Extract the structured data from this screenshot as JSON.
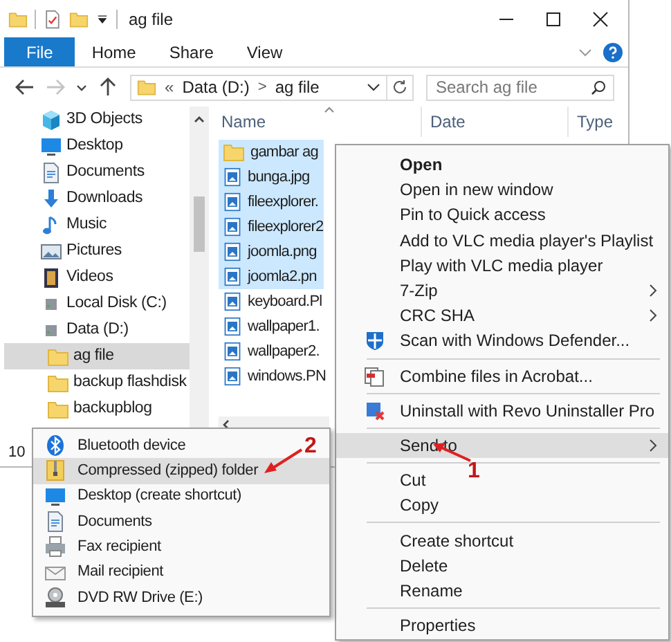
{
  "window": {
    "title": "ag file"
  },
  "ribbon": {
    "tabs": [
      {
        "label": "File",
        "kind": "file",
        "selected": false
      },
      {
        "label": "Home",
        "kind": "tab",
        "selected": false
      },
      {
        "label": "Share",
        "kind": "tab",
        "selected": false
      },
      {
        "label": "View",
        "kind": "tab",
        "selected": false
      }
    ]
  },
  "navigation": {
    "buttons": [
      {
        "kind": "back",
        "disabled": false
      },
      {
        "kind": "forward",
        "disabled": true
      },
      {
        "kind": "recent",
        "disabled": false
      },
      {
        "kind": "up",
        "disabled": false
      }
    ]
  },
  "address_bar": {
    "overflow": "«",
    "separator": ">",
    "path": [
      "Data (D:)",
      "ag file"
    ]
  },
  "search": {
    "placeholder": "Search ag file"
  },
  "nav_pane": {
    "items": [
      {
        "label": "3D Objects",
        "kind": "objects3d",
        "selected": false,
        "indented": false
      },
      {
        "label": "Desktop",
        "kind": "desktop",
        "selected": false,
        "indented": false
      },
      {
        "label": "Documents",
        "kind": "documents",
        "selected": false,
        "indented": false
      },
      {
        "label": "Downloads",
        "kind": "downloads",
        "selected": false,
        "indented": false
      },
      {
        "label": "Music",
        "kind": "music",
        "selected": false,
        "indented": false
      },
      {
        "label": "Pictures",
        "kind": "pictures",
        "selected": false,
        "indented": false
      },
      {
        "label": "Videos",
        "kind": "videos",
        "selected": false,
        "indented": false
      },
      {
        "label": "Local Disk (C:)",
        "kind": "drive",
        "selected": false,
        "indented": false
      },
      {
        "label": "Data (D:)",
        "kind": "drive",
        "selected": false,
        "indented": false
      },
      {
        "label": "ag file",
        "kind": "folder",
        "selected": true,
        "indented": true
      },
      {
        "label": "backup flashdisk",
        "kind": "folder",
        "selected": false,
        "indented": true
      },
      {
        "label": "backupblog",
        "kind": "folder",
        "selected": false,
        "indented": true
      }
    ]
  },
  "file_list": {
    "columns": [
      "Name",
      "Date",
      "Type"
    ],
    "rows": [
      {
        "name": "gambar ag",
        "kind": "folder",
        "selected": true
      },
      {
        "name": "bunga.jpg",
        "kind": "image",
        "selected": true
      },
      {
        "name": "fileexplorer.",
        "kind": "image",
        "selected": true
      },
      {
        "name": "fileexplorer2",
        "kind": "image",
        "selected": true
      },
      {
        "name": "joomla.png",
        "kind": "image",
        "selected": true
      },
      {
        "name": "joomla2.pn",
        "kind": "image",
        "selected": true
      },
      {
        "name": "keyboard.Pl",
        "kind": "image",
        "selected": false
      },
      {
        "name": "wallpaper1.",
        "kind": "image",
        "selected": false
      },
      {
        "name": "wallpaper2.",
        "kind": "image",
        "selected": false
      },
      {
        "name": "windows.PN",
        "kind": "image",
        "selected": false
      }
    ]
  },
  "status_bar": {
    "text": "10"
  },
  "context_menu": {
    "items": [
      {
        "label": "Open",
        "kind": "plain",
        "default": true,
        "submenu": false,
        "selected": false
      },
      {
        "label": "Open in new window",
        "kind": "plain",
        "default": false,
        "submenu": false,
        "selected": false
      },
      {
        "label": "Pin to Quick access",
        "kind": "plain",
        "default": false,
        "submenu": false,
        "selected": false
      },
      {
        "label": "Add to VLC media player's Playlist",
        "kind": "plain",
        "default": false,
        "submenu": false,
        "selected": false
      },
      {
        "label": "Play with VLC media player",
        "kind": "plain",
        "default": false,
        "submenu": false,
        "selected": false
      },
      {
        "label": "7-Zip",
        "kind": "plain",
        "default": false,
        "submenu": true,
        "selected": false
      },
      {
        "label": "CRC SHA",
        "kind": "plain",
        "default": false,
        "submenu": true,
        "selected": false
      },
      {
        "label": "Scan with Windows Defender...",
        "kind": "shield",
        "default": false,
        "submenu": false,
        "selected": false
      },
      {
        "kind": "separator"
      },
      {
        "label": "Combine files in Acrobat...",
        "kind": "acrobat",
        "default": false,
        "submenu": false,
        "selected": false
      },
      {
        "kind": "separator"
      },
      {
        "label": "Uninstall with Revo Uninstaller Pro",
        "kind": "revo",
        "default": false,
        "submenu": false,
        "selected": false
      },
      {
        "kind": "separator"
      },
      {
        "label": "Send to",
        "kind": "plain",
        "default": false,
        "submenu": true,
        "selected": true
      },
      {
        "kind": "separator"
      },
      {
        "label": "Cut",
        "kind": "plain",
        "default": false,
        "submenu": false,
        "selected": false
      },
      {
        "label": "Copy",
        "kind": "plain",
        "default": false,
        "submenu": false,
        "selected": false
      },
      {
        "kind": "separator"
      },
      {
        "label": "Create shortcut",
        "kind": "plain",
        "default": false,
        "submenu": false,
        "selected": false
      },
      {
        "label": "Delete",
        "kind": "plain",
        "default": false,
        "submenu": false,
        "selected": false
      },
      {
        "label": "Rename",
        "kind": "plain",
        "default": false,
        "submenu": false,
        "selected": false
      },
      {
        "kind": "separator"
      },
      {
        "label": "Properties",
        "kind": "plain",
        "default": false,
        "submenu": false,
        "selected": false
      }
    ]
  },
  "send_to_menu": {
    "items": [
      {
        "label": "Bluetooth device",
        "kind": "bluetooth",
        "selected": false
      },
      {
        "label": "Compressed (zipped) folder",
        "kind": "zip",
        "selected": true
      },
      {
        "label": "Desktop (create shortcut)",
        "kind": "desktop",
        "selected": false
      },
      {
        "label": "Documents",
        "kind": "documents",
        "selected": false
      },
      {
        "label": "Fax recipient",
        "kind": "fax",
        "selected": false
      },
      {
        "label": "Mail recipient",
        "kind": "mail",
        "selected": false
      },
      {
        "label": "DVD RW Drive (E:)",
        "kind": "dvd",
        "selected": false
      }
    ]
  },
  "annotations": [
    {
      "label": "1"
    },
    {
      "label": "2"
    }
  ]
}
